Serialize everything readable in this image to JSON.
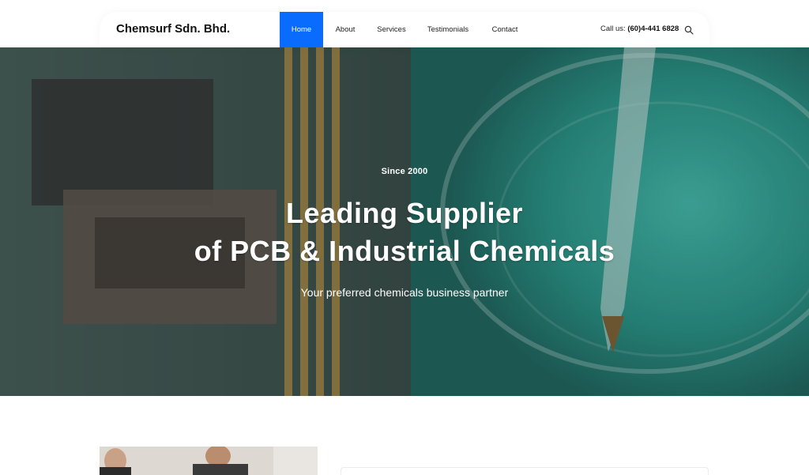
{
  "brand": {
    "name": "Chemsurf Sdn. Bhd."
  },
  "nav": {
    "items": [
      {
        "label": "Home",
        "active": true
      },
      {
        "label": "About",
        "active": false
      },
      {
        "label": "Services",
        "active": false
      },
      {
        "label": "Testimonials",
        "active": false
      },
      {
        "label": "Contact",
        "active": false
      }
    ],
    "call_prefix": "Call us:",
    "phone": "(60)4-441 6828",
    "search_icon": "search-icon"
  },
  "hero": {
    "since": "Since 2000",
    "title_line1": "Leading Supplier",
    "title_line2": "of PCB & Industrial Chemicals",
    "subtitle": "Your preferred chemicals business partner"
  },
  "colors": {
    "accent": "#0a6cff",
    "hero_teal": "#1f9c8c",
    "text": "#111111"
  }
}
